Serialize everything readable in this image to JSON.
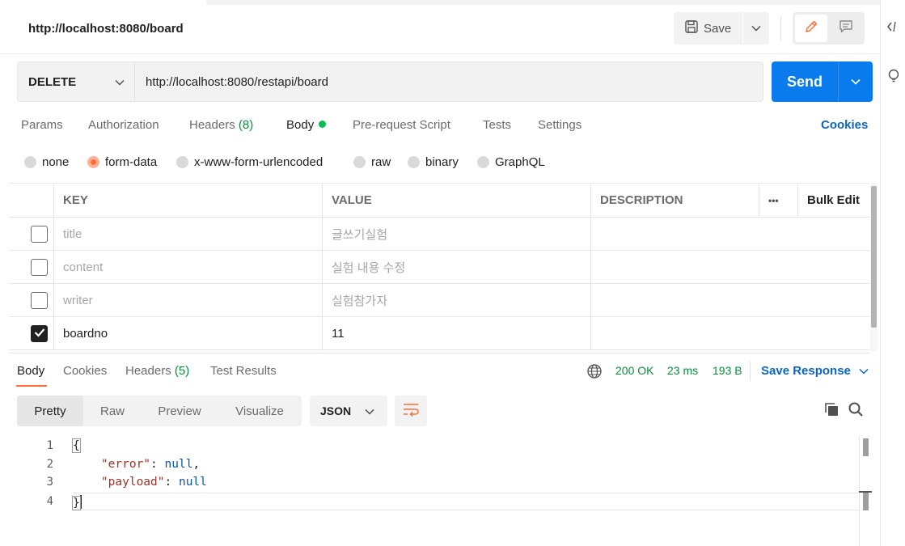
{
  "header": {
    "title": "http://localhost:8080/board",
    "save_label": "Save"
  },
  "request": {
    "method": "DELETE",
    "url": "http://localhost:8080/restapi/board",
    "send_label": "Send"
  },
  "request_tabs": {
    "params": "Params",
    "authorization": "Authorization",
    "headers": "Headers",
    "headers_count": "(8)",
    "body": "Body",
    "prerequest": "Pre-request Script",
    "tests": "Tests",
    "settings": "Settings",
    "cookies": "Cookies",
    "active": "Body"
  },
  "body_types": {
    "none": "none",
    "form_data": "form-data",
    "urlencoded": "x-www-form-urlencoded",
    "raw": "raw",
    "binary": "binary",
    "graphql": "GraphQL",
    "selected": "form-data"
  },
  "params_table": {
    "headers": {
      "key": "KEY",
      "value": "VALUE",
      "description": "DESCRIPTION",
      "more": "•••",
      "bulk_edit": "Bulk Edit"
    },
    "rows": [
      {
        "checked": false,
        "key": "title",
        "value": "글쓰기실험",
        "description": ""
      },
      {
        "checked": false,
        "key": "content",
        "value": "실험 내용 수정",
        "description": ""
      },
      {
        "checked": false,
        "key": "writer",
        "value": "실험참가자",
        "description": ""
      },
      {
        "checked": true,
        "key": "boardno",
        "value": "11",
        "description": ""
      }
    ]
  },
  "response": {
    "tabs": {
      "body": "Body",
      "cookies": "Cookies",
      "headers": "Headers",
      "headers_count": "(5)",
      "test_results": "Test Results"
    },
    "status": "200 OK",
    "time": "23 ms",
    "size": "193 B",
    "save_response": "Save Response",
    "views": {
      "pretty": "Pretty",
      "raw": "Raw",
      "preview": "Preview",
      "visualize": "Visualize",
      "active": "Pretty"
    },
    "format": "JSON",
    "code": {
      "line_numbers": [
        "1",
        "2",
        "3",
        "4"
      ],
      "open_brace": "{",
      "close_brace": "}",
      "key1": "\"error\"",
      "val1": "null",
      "key2": "\"payload\"",
      "val2": "null"
    }
  },
  "colors": {
    "accent": "#ff6c37",
    "send": "#097bed",
    "link": "#0b65c2",
    "success": "#0b8d3b"
  },
  "icons": [
    "save-icon",
    "chevron-down-icon",
    "pencil-icon",
    "comment-icon",
    "code-icon",
    "lightbulb-icon",
    "globe-icon",
    "wrap-lines-icon",
    "copy-icon",
    "search-icon",
    "checkmark-icon"
  ]
}
